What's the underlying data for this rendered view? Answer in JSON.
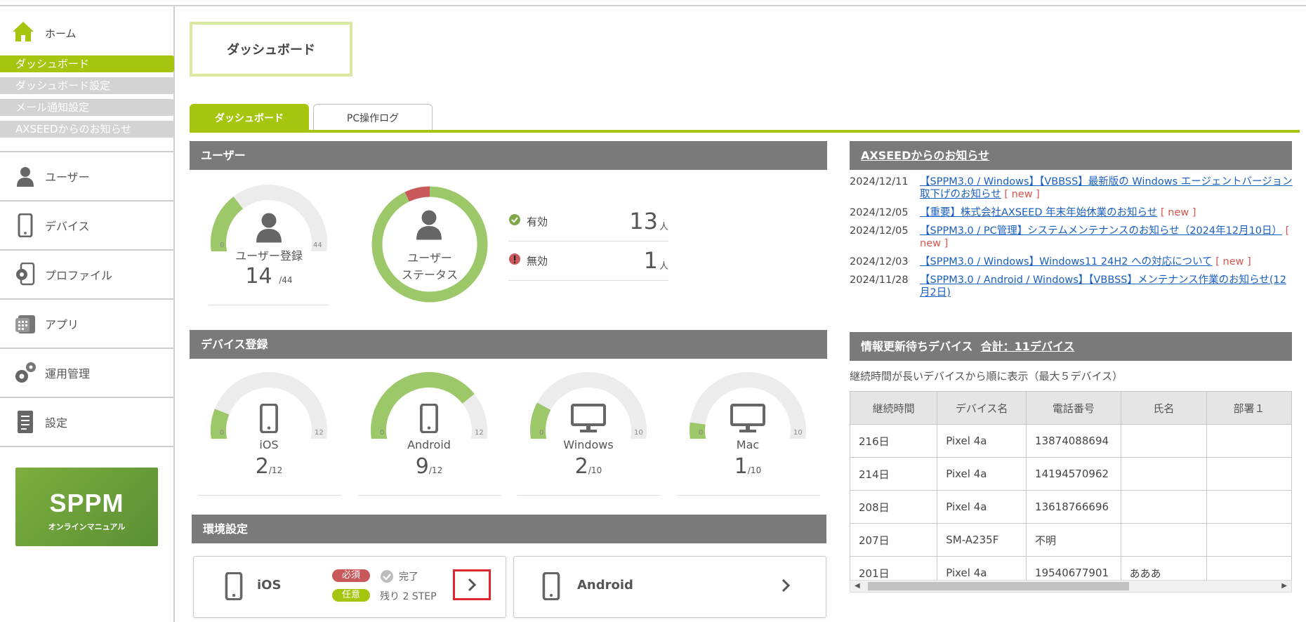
{
  "sidebar": {
    "home_label": "ホーム",
    "subnav": [
      "ダッシュボード",
      "ダッシュボード設定",
      "メール通知設定",
      "AXSEEDからのお知らせ"
    ],
    "items": [
      {
        "label": "ユーザー",
        "icon": "user-icon"
      },
      {
        "label": "デバイス",
        "icon": "smartphone-icon"
      },
      {
        "label": "プロファイル",
        "icon": "profile-gear-icon"
      },
      {
        "label": "アプリ",
        "icon": "app-grid-icon"
      },
      {
        "label": "運用管理",
        "icon": "gears-icon"
      },
      {
        "label": "設定",
        "icon": "document-icon"
      }
    ],
    "banner": {
      "title": "SPPM",
      "subtitle": "オンラインマニュアル"
    }
  },
  "page_title": "ダッシュボード",
  "tabs": [
    "ダッシュボード",
    "PC操作ログ"
  ],
  "users": {
    "header": "ユーザー",
    "registration": {
      "label": "ユーザー登録",
      "value": "14",
      "max": "/44",
      "min_tick": "0",
      "max_tick": "44",
      "fraction": 0.318
    },
    "status_label_1": "ユーザー",
    "status_label_2": "ステータス",
    "active": {
      "label": "有効",
      "count": "13",
      "unit": "人"
    },
    "inactive": {
      "label": "無効",
      "count": "1",
      "unit": "人"
    },
    "status_fraction_inactive": 0.071
  },
  "devices": {
    "header": "デバイス登録",
    "items": [
      {
        "label": "iOS",
        "value": "2",
        "max": "/12",
        "min_tick": "0",
        "max_tick": "12",
        "fraction": 0.167,
        "icon": "smartphone-icon"
      },
      {
        "label": "Android",
        "value": "9",
        "max": "/12",
        "min_tick": "0",
        "max_tick": "12",
        "fraction": 0.75,
        "icon": "smartphone-icon"
      },
      {
        "label": "Windows",
        "value": "2",
        "max": "/10",
        "min_tick": "0",
        "max_tick": "10",
        "fraction": 0.2,
        "icon": "monitor-icon"
      },
      {
        "label": "Mac",
        "value": "1",
        "max": "/10",
        "min_tick": "0",
        "max_tick": "10",
        "fraction": 0.1,
        "icon": "monitor-icon"
      }
    ]
  },
  "env": {
    "header": "環境設定",
    "ios": {
      "title": "iOS",
      "required": "必須",
      "done": "完了",
      "optional": "任意",
      "remaining": "残り 2 STEP"
    },
    "android": {
      "title": "Android"
    }
  },
  "news": {
    "header": "AXSEEDからのお知らせ",
    "items": [
      {
        "date": "2024/12/11",
        "text": "【SPPM3.0 / Windows】【VBBSS】最新版の Windows エージェントバージョン取下げのお知らせ",
        "new": "[ new ]"
      },
      {
        "date": "2024/12/05",
        "text": "【重要】株式会社AXSEED 年末年始休業のお知らせ",
        "new": "[ new ]"
      },
      {
        "date": "2024/12/05",
        "text": "【SPPM3.0 / PC管理】システムメンテナンスのお知らせ（2024年12月10日）",
        "new": "[ new ]"
      },
      {
        "date": "2024/12/03",
        "text": "【SPPM3.0 / Windows】Windows11 24H2 への対応について",
        "new": "[ new ]"
      },
      {
        "date": "2024/11/28",
        "text": "【SPPM3.0 / Android / Windows】【VBBSS】メンテナンス作業のお知らせ(12月2日)",
        "new": ""
      }
    ]
  },
  "pending": {
    "header": "情報更新待ちデバイス",
    "total": "合計：11デバイス",
    "note": "継続時間が長いデバイスから順に表示（最大５デバイス）",
    "columns": [
      "継続時間",
      "デバイス名",
      "電話番号",
      "氏名",
      "部署１"
    ],
    "rows": [
      [
        "216日",
        "Pixel 4a",
        "13874088694",
        "",
        ""
      ],
      [
        "214日",
        "Pixel 4a",
        "14194570962",
        "",
        ""
      ],
      [
        "208日",
        "Pixel 4a",
        "13618766696",
        "",
        ""
      ],
      [
        "207日",
        "SM-A235F",
        "不明",
        "",
        ""
      ],
      [
        "201日",
        "Pixel 4a",
        "19540677901",
        "あああ",
        ""
      ]
    ]
  },
  "colors": {
    "accent": "#a6c50e",
    "gauge_fill": "#9dc86a",
    "gauge_bg": "#ececec",
    "inactive": "#c9585a",
    "header": "#7a7a7a"
  }
}
